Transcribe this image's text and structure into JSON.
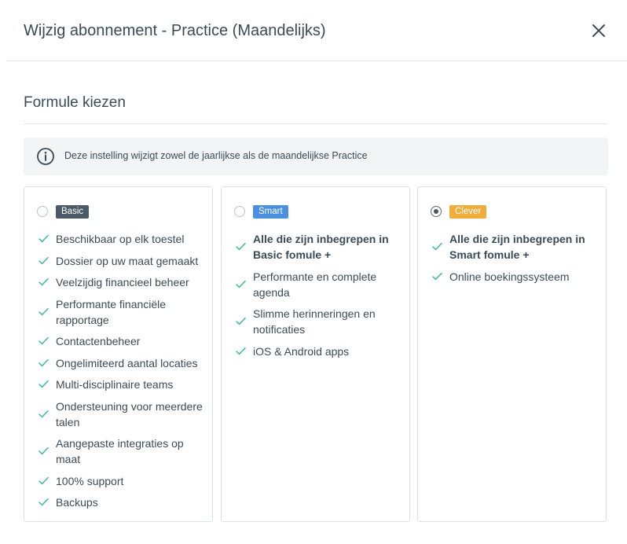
{
  "modal": {
    "title": "Wijzig abonnement - Practice (Maandelijks)",
    "close_icon": "close-icon"
  },
  "section": {
    "title": "Formule kiezen"
  },
  "info": {
    "icon": "info-icon",
    "text": "Deze instelling wijzigt zowel de jaarlijkse als de maandelijkse Practice"
  },
  "colors": {
    "check": "#3db8a0",
    "basic_badge": "#4a5a68",
    "smart_badge": "#4a8fe0",
    "clever_badge": "#f0ad3c"
  },
  "plans": [
    {
      "badge": "Basic",
      "selected": false,
      "features": [
        "Beschikbaar op elk toestel",
        "Dossier op uw maat gemaakt",
        "Veelzijdig financieel beheer",
        "Performante financiële rapportage",
        "Contactenbeheer",
        "Ongelimiteerd aantal locaties",
        "Multi-disciplinaire teams",
        "Ondersteuning voor meerdere talen",
        "Aangepaste integraties op maat",
        "100% support",
        "Backups"
      ]
    },
    {
      "badge": "Smart",
      "selected": false,
      "features": [
        "Alle die zijn inbegrepen in Basic fomule +",
        "Performante en complete agenda",
        "Slimme herinneringen en notificaties",
        "iOS & Android apps"
      ]
    },
    {
      "badge": "Clever",
      "selected": true,
      "features": [
        "Alle die zijn inbegrepen in Smart fomule +",
        "Online boekingssysteem"
      ]
    }
  ]
}
